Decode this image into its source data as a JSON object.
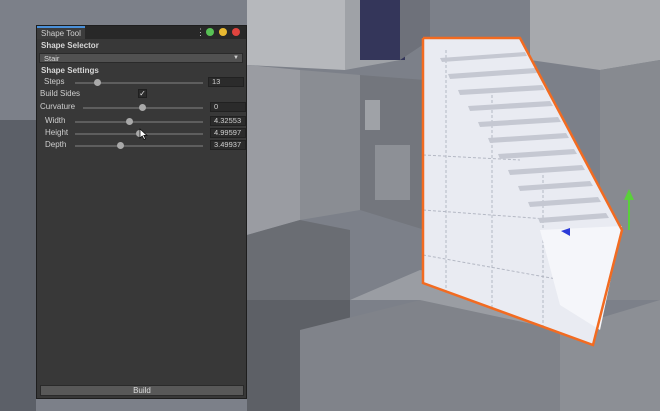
{
  "panel": {
    "tab_title": "Shape Tool",
    "menu_icon": "kebab-menu-icon",
    "window_buttons": [
      "#58c155",
      "#e8b931",
      "#e0443e"
    ],
    "shape_selector": {
      "header": "Shape Selector",
      "selected": "Stair"
    },
    "shape_settings": {
      "header": "Shape Settings",
      "steps": {
        "label": "Steps",
        "value": "13",
        "slider_fraction": 0.2
      },
      "build_sides": {
        "label": "Build Sides",
        "checked": true,
        "check_glyph": "✓"
      },
      "curvature": {
        "label": "Curvature",
        "value": "0",
        "slider_fraction": 0.5
      },
      "width": {
        "label": "Width",
        "value": "4.32553",
        "slider_fraction": 0.42
      },
      "height": {
        "label": "Height",
        "value": "4.99597",
        "slider_fraction": 0.48
      },
      "depth": {
        "label": "Depth",
        "value": "3.49937",
        "slider_fraction": 0.35
      }
    },
    "build_label": "Build"
  },
  "viewport": {
    "selection_color": "#f26b21",
    "gizmo_colors": {
      "y": "#5ad03a",
      "x": "#2b3ad8"
    }
  }
}
